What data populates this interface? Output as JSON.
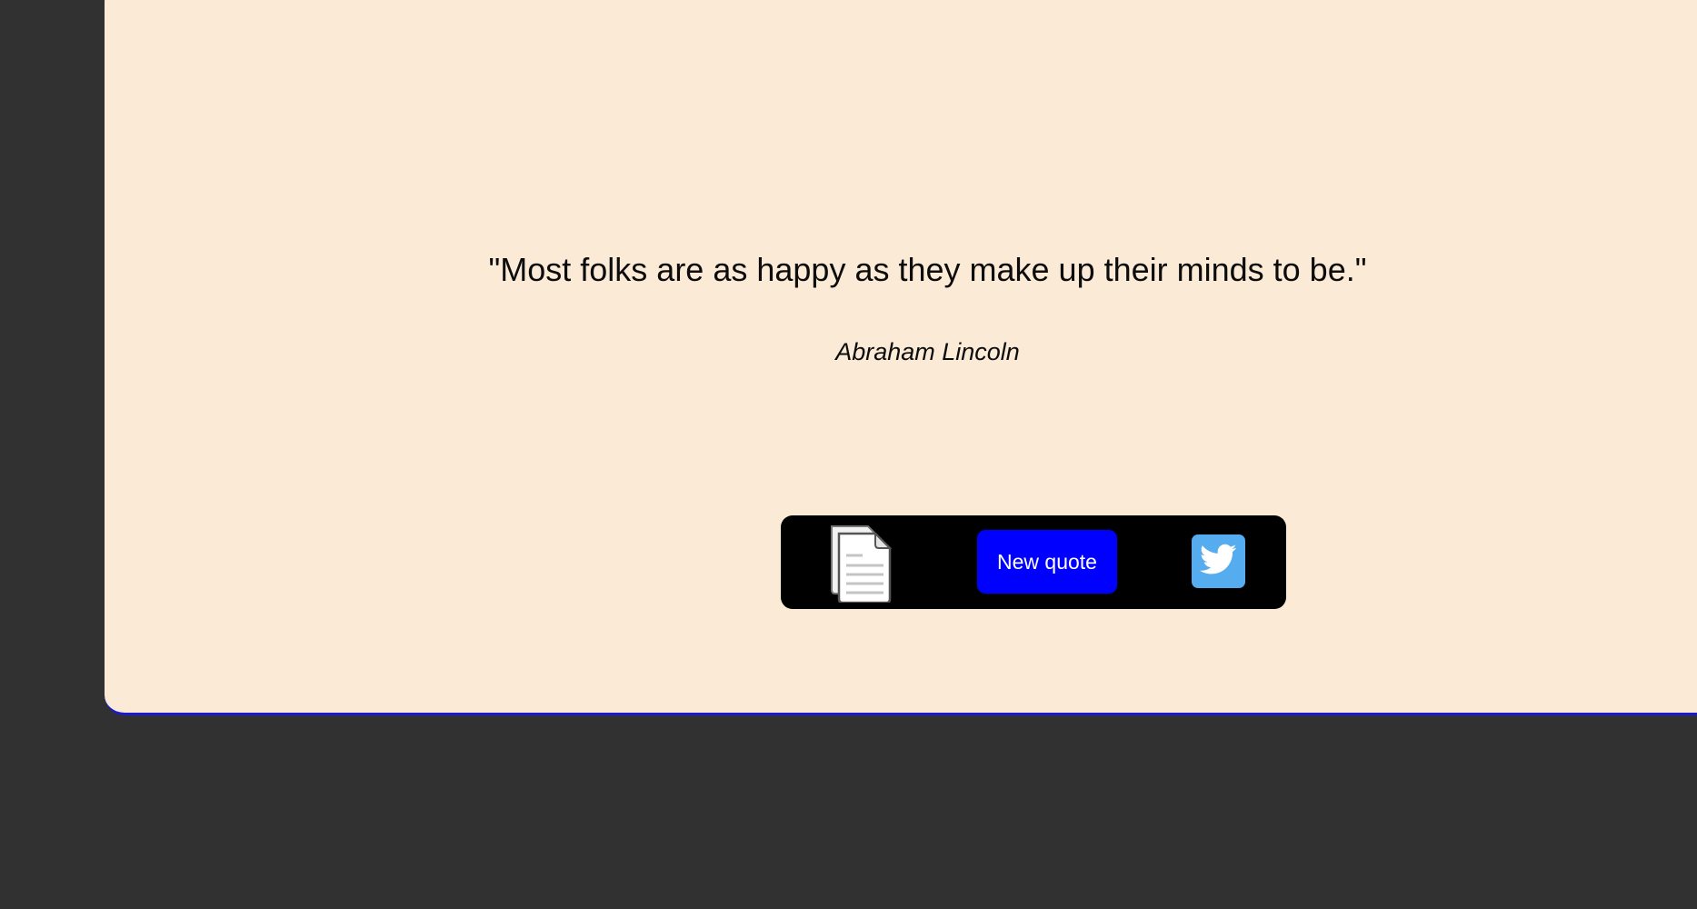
{
  "quote": {
    "text": "\"Most folks are as happy as they make up their minds to be.\"",
    "author": "Abraham Lincoln"
  },
  "toolbar": {
    "copy_icon": "copy-document-icon",
    "new_quote_label": "New quote",
    "tweet_icon": "twitter-icon"
  },
  "colors": {
    "page_background": "#313131",
    "card_background": "#fbebd6",
    "toolbar_background": "#000000",
    "new_quote_button": "#0000ff",
    "twitter_button": "#55acee"
  }
}
